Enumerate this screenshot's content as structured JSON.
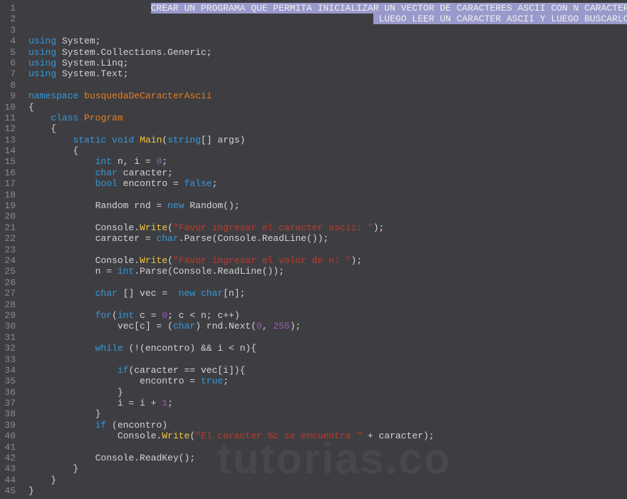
{
  "watermark": "tutorias.co",
  "lines": [
    {
      "num": 1,
      "segments": [
        {
          "indent": 22
        },
        {
          "t": "CREAR UN PROGRAMA QUE PERMITA INICIALIZAR UN VECTOR DE CARACTERES ASCII CON N CARACTERES",
          "cls": "selection"
        }
      ]
    },
    {
      "num": 2,
      "segments": [
        {
          "indent": 62
        },
        {
          "t": " LUEGO LEER UN CARACTER ASCII Y LUEGO BUSCARLO",
          "cls": "selection"
        }
      ]
    },
    {
      "num": 3,
      "segments": []
    },
    {
      "num": 4,
      "segments": [
        {
          "t": "using",
          "cls": "kw"
        },
        {
          "t": " System;",
          "cls": "ident"
        }
      ]
    },
    {
      "num": 5,
      "segments": [
        {
          "t": "using",
          "cls": "kw"
        },
        {
          "t": " System.Collections.Generic;",
          "cls": "ident"
        }
      ]
    },
    {
      "num": 6,
      "segments": [
        {
          "t": "using",
          "cls": "kw"
        },
        {
          "t": " System.Linq;",
          "cls": "ident"
        }
      ]
    },
    {
      "num": 7,
      "segments": [
        {
          "t": "using",
          "cls": "kw"
        },
        {
          "t": " System.Text;",
          "cls": "ident"
        }
      ]
    },
    {
      "num": 8,
      "segments": []
    },
    {
      "num": 9,
      "segments": [
        {
          "t": "namespace",
          "cls": "kw"
        },
        {
          "t": " ",
          "cls": "ident"
        },
        {
          "t": "busquedaDeCaracterAscii",
          "cls": "cls"
        }
      ]
    },
    {
      "num": 10,
      "segments": [
        {
          "t": "{",
          "cls": "punc"
        }
      ]
    },
    {
      "num": 11,
      "segments": [
        {
          "indent": 4
        },
        {
          "t": "class",
          "cls": "kw"
        },
        {
          "t": " ",
          "cls": "ident"
        },
        {
          "t": "Program",
          "cls": "cls"
        }
      ]
    },
    {
      "num": 12,
      "segments": [
        {
          "indent": 4
        },
        {
          "t": "{",
          "cls": "punc"
        }
      ]
    },
    {
      "num": 13,
      "segments": [
        {
          "indent": 8
        },
        {
          "t": "static",
          "cls": "kw"
        },
        {
          "t": " ",
          "cls": "ident"
        },
        {
          "t": "void",
          "cls": "type"
        },
        {
          "t": " ",
          "cls": "ident"
        },
        {
          "t": "Main",
          "cls": "method"
        },
        {
          "t": "(",
          "cls": "punc"
        },
        {
          "t": "string",
          "cls": "type"
        },
        {
          "t": "[] args)",
          "cls": "ident"
        }
      ]
    },
    {
      "num": 14,
      "segments": [
        {
          "indent": 8
        },
        {
          "t": "{",
          "cls": "punc"
        }
      ]
    },
    {
      "num": 15,
      "segments": [
        {
          "indent": 12
        },
        {
          "t": "int",
          "cls": "type"
        },
        {
          "t": " n, i = ",
          "cls": "ident"
        },
        {
          "t": "0",
          "cls": "num"
        },
        {
          "t": ";",
          "cls": "punc"
        }
      ]
    },
    {
      "num": 16,
      "segments": [
        {
          "indent": 12
        },
        {
          "t": "char",
          "cls": "type"
        },
        {
          "t": " caracter;",
          "cls": "ident"
        }
      ]
    },
    {
      "num": 17,
      "segments": [
        {
          "indent": 12
        },
        {
          "t": "bool",
          "cls": "type"
        },
        {
          "t": " encontro = ",
          "cls": "ident"
        },
        {
          "t": "false",
          "cls": "kw"
        },
        {
          "t": ";",
          "cls": "punc"
        }
      ]
    },
    {
      "num": 18,
      "segments": []
    },
    {
      "num": 19,
      "segments": [
        {
          "indent": 12
        },
        {
          "t": "Random rnd = ",
          "cls": "ident"
        },
        {
          "t": "new",
          "cls": "kw"
        },
        {
          "t": " Random();",
          "cls": "ident"
        }
      ]
    },
    {
      "num": 20,
      "segments": []
    },
    {
      "num": 21,
      "segments": [
        {
          "indent": 12
        },
        {
          "t": "Console.",
          "cls": "ident"
        },
        {
          "t": "Write",
          "cls": "kw2"
        },
        {
          "t": "(",
          "cls": "punc"
        },
        {
          "t": "\"Favor ingresar el caracter ascii: \"",
          "cls": "str"
        },
        {
          "t": ");",
          "cls": "punc"
        }
      ]
    },
    {
      "num": 22,
      "segments": [
        {
          "indent": 12
        },
        {
          "t": "caracter = ",
          "cls": "ident"
        },
        {
          "t": "char",
          "cls": "type"
        },
        {
          "t": ".Parse(Console.ReadLine());",
          "cls": "ident"
        }
      ]
    },
    {
      "num": 23,
      "segments": []
    },
    {
      "num": 24,
      "segments": [
        {
          "indent": 12
        },
        {
          "t": "Console.",
          "cls": "ident"
        },
        {
          "t": "Write",
          "cls": "kw2"
        },
        {
          "t": "(",
          "cls": "punc"
        },
        {
          "t": "\"Favor ingresar el valor de n: \"",
          "cls": "str"
        },
        {
          "t": ");",
          "cls": "punc"
        }
      ]
    },
    {
      "num": 25,
      "segments": [
        {
          "indent": 12
        },
        {
          "t": "n = ",
          "cls": "ident"
        },
        {
          "t": "int",
          "cls": "type"
        },
        {
          "t": ".Parse(Console.ReadLine());",
          "cls": "ident"
        }
      ]
    },
    {
      "num": 26,
      "segments": []
    },
    {
      "num": 27,
      "segments": [
        {
          "indent": 12
        },
        {
          "t": "char",
          "cls": "type"
        },
        {
          "t": " [] vec =  ",
          "cls": "ident"
        },
        {
          "t": "new",
          "cls": "kw"
        },
        {
          "t": " ",
          "cls": "ident"
        },
        {
          "t": "char",
          "cls": "type"
        },
        {
          "t": "[n];",
          "cls": "ident"
        }
      ]
    },
    {
      "num": 28,
      "segments": []
    },
    {
      "num": 29,
      "segments": [
        {
          "indent": 12
        },
        {
          "t": "for",
          "cls": "kw"
        },
        {
          "t": "(",
          "cls": "punc"
        },
        {
          "t": "int",
          "cls": "type"
        },
        {
          "t": " c = ",
          "cls": "ident"
        },
        {
          "t": "0",
          "cls": "num"
        },
        {
          "t": "; c < n; c++)",
          "cls": "ident"
        }
      ]
    },
    {
      "num": 30,
      "segments": [
        {
          "indent": 16
        },
        {
          "t": "vec[c] = (",
          "cls": "ident"
        },
        {
          "t": "char",
          "cls": "type"
        },
        {
          "t": ") rnd.Next(",
          "cls": "ident"
        },
        {
          "t": "0",
          "cls": "num"
        },
        {
          "t": ", ",
          "cls": "ident"
        },
        {
          "t": "255",
          "cls": "num"
        },
        {
          "t": ");",
          "cls": "punc"
        }
      ]
    },
    {
      "num": 31,
      "segments": []
    },
    {
      "num": 32,
      "segments": [
        {
          "indent": 12
        },
        {
          "t": "while",
          "cls": "kw"
        },
        {
          "t": " (!(encontro) && i < n){",
          "cls": "ident"
        }
      ]
    },
    {
      "num": 33,
      "segments": []
    },
    {
      "num": 34,
      "segments": [
        {
          "indent": 16
        },
        {
          "t": "if",
          "cls": "kw"
        },
        {
          "t": "(caracter == vec[i]){",
          "cls": "ident"
        }
      ]
    },
    {
      "num": 35,
      "segments": [
        {
          "indent": 20
        },
        {
          "t": "encontro = ",
          "cls": "ident"
        },
        {
          "t": "true",
          "cls": "kw"
        },
        {
          "t": ";",
          "cls": "punc"
        }
      ]
    },
    {
      "num": 36,
      "segments": [
        {
          "indent": 16
        },
        {
          "t": "}",
          "cls": "punc"
        }
      ]
    },
    {
      "num": 37,
      "segments": [
        {
          "indent": 16
        },
        {
          "t": "i = i + ",
          "cls": "ident"
        },
        {
          "t": "1",
          "cls": "num"
        },
        {
          "t": ";",
          "cls": "punc"
        }
      ]
    },
    {
      "num": 38,
      "segments": [
        {
          "indent": 12
        },
        {
          "t": "}",
          "cls": "punc"
        }
      ]
    },
    {
      "num": 39,
      "segments": [
        {
          "indent": 12
        },
        {
          "t": "if",
          "cls": "kw"
        },
        {
          "t": " (encontro)",
          "cls": "ident"
        }
      ]
    },
    {
      "num": 40,
      "segments": [
        {
          "indent": 16
        },
        {
          "t": "Console.",
          "cls": "ident"
        },
        {
          "t": "Write",
          "cls": "kw2"
        },
        {
          "t": "(",
          "cls": "punc"
        },
        {
          "t": "\"El caracter %c se encuentra \"",
          "cls": "str"
        },
        {
          "t": " + caracter);",
          "cls": "ident"
        }
      ]
    },
    {
      "num": 41,
      "segments": []
    },
    {
      "num": 42,
      "segments": [
        {
          "indent": 12
        },
        {
          "t": "Console.ReadKey();",
          "cls": "ident"
        }
      ]
    },
    {
      "num": 43,
      "segments": [
        {
          "indent": 8
        },
        {
          "t": "}",
          "cls": "punc"
        }
      ]
    },
    {
      "num": 44,
      "segments": [
        {
          "indent": 4
        },
        {
          "t": "}",
          "cls": "punc"
        }
      ]
    },
    {
      "num": 45,
      "segments": [
        {
          "t": "}",
          "cls": "punc"
        }
      ]
    }
  ]
}
